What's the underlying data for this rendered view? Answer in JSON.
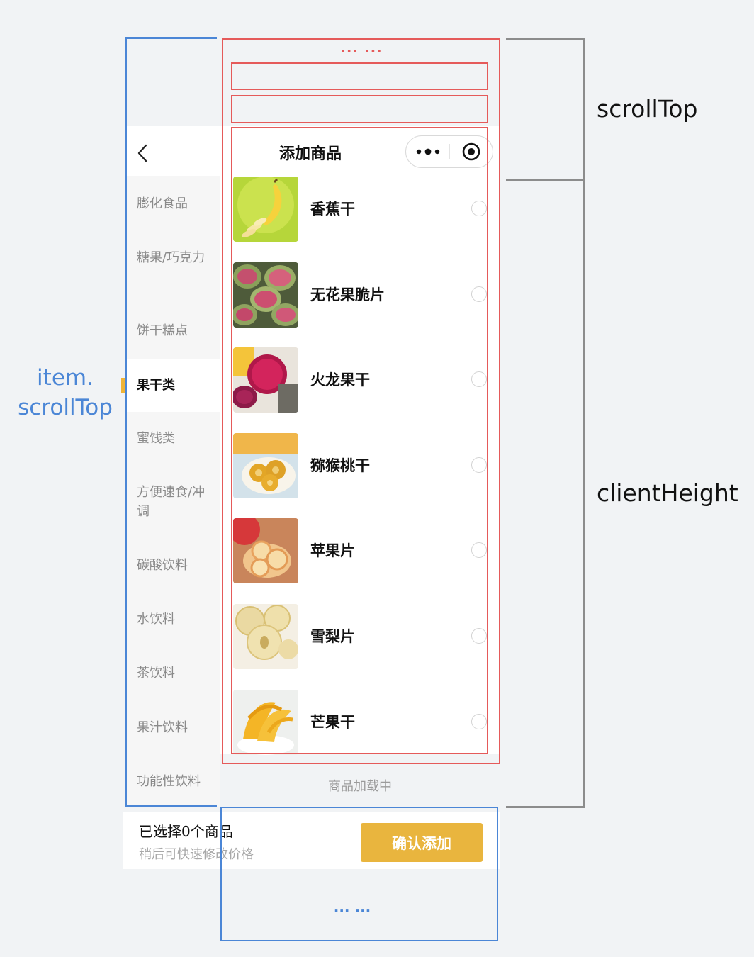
{
  "nav": {
    "title": "添加商品",
    "back_icon": "chevron-left-icon",
    "more_icon": "more-dots-icon",
    "close_icon": "target-circle-icon"
  },
  "sidebar": {
    "active_color": "#efb437",
    "items": [
      {
        "label": "膨化食品"
      },
      {
        "label": "糖果/巧克力"
      },
      {
        "label": "饼干糕点"
      },
      {
        "label": "果干类",
        "active": true
      },
      {
        "label": "蜜饯类"
      },
      {
        "label": "方便速食/冲调"
      },
      {
        "label": "碳酸饮料"
      },
      {
        "label": "水饮料"
      },
      {
        "label": "茶饮料"
      },
      {
        "label": "果汁饮料"
      },
      {
        "label": "功能性饮料"
      }
    ]
  },
  "products": [
    {
      "name": "香蕉干",
      "image": "banana-chips-photo",
      "selected": false
    },
    {
      "name": "无花果脆片",
      "image": "fig-slices-photo",
      "selected": false
    },
    {
      "name": "火龙果干",
      "image": "dragon-fruit-photo",
      "selected": false
    },
    {
      "name": "猕猴桃干",
      "image": "kiwi-slices-photo",
      "selected": false
    },
    {
      "name": "苹果片",
      "image": "apple-chips-photo",
      "selected": false
    },
    {
      "name": "雪梨片",
      "image": "pear-chips-photo",
      "selected": false
    },
    {
      "name": "芒果干",
      "image": "dried-mango-photo",
      "selected": false
    }
  ],
  "loading_text": "商品加载中",
  "footer": {
    "selected_text": "已选择0个商品",
    "tip": "稍后可快速修改价格",
    "confirm_label": "确认添加",
    "confirm_color": "#e9b53e"
  },
  "annotations": {
    "scroll_top": "scrollTop",
    "client_height": "clientHeight",
    "item_scroll_top": "item.\nscrollTop",
    "dots_red": "··· ···",
    "dots_blue": "··· ···",
    "red_color": "#e55a5a",
    "blue_color": "#4b86d6"
  }
}
